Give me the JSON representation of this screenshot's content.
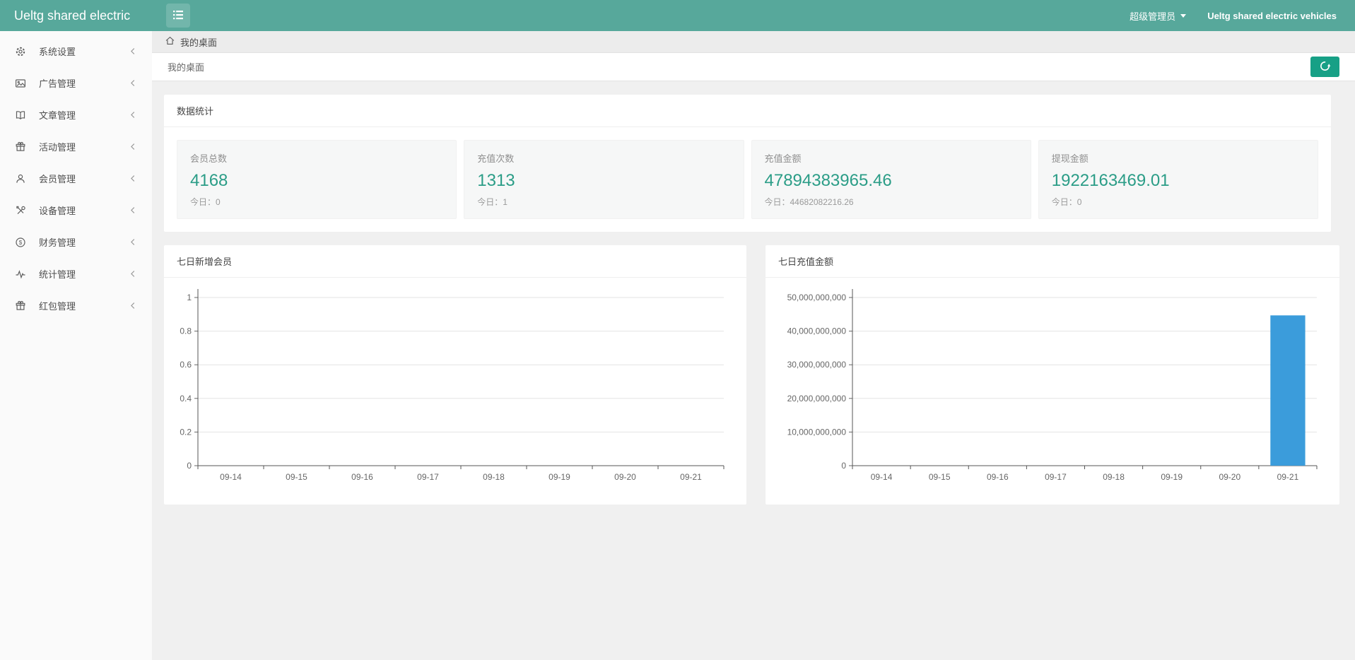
{
  "header": {
    "title": "Ueltg shared electric",
    "menu_icon": "hamburger-icon",
    "admin_role": "超级管理员",
    "site_name": "Ueltg shared electric vehicles"
  },
  "sidebar": {
    "items": [
      {
        "key": "settings",
        "icon": "gear",
        "label": "系统设置"
      },
      {
        "key": "ads",
        "icon": "image",
        "label": "广告管理"
      },
      {
        "key": "articles",
        "icon": "book",
        "label": "文章管理"
      },
      {
        "key": "activities",
        "icon": "gift",
        "label": "活动管理"
      },
      {
        "key": "members",
        "icon": "user",
        "label": "会员管理"
      },
      {
        "key": "devices",
        "icon": "wrench",
        "label": "设备管理"
      },
      {
        "key": "finance",
        "icon": "dollar",
        "label": "财务管理"
      },
      {
        "key": "statistics",
        "icon": "pulse",
        "label": "统计管理"
      },
      {
        "key": "redpacket",
        "icon": "gift",
        "label": "红包管理"
      }
    ]
  },
  "breadcrumb": {
    "icon": "home-icon",
    "label": "我的桌面"
  },
  "tab": {
    "label": "我的桌面",
    "refresh_icon": "refresh-icon"
  },
  "stats": {
    "section_title": "数据统计",
    "today_prefix": "今日：",
    "cards": [
      {
        "label": "会员总数",
        "value": "4168",
        "today": "0"
      },
      {
        "label": "充值次数",
        "value": "1313",
        "today": "1"
      },
      {
        "label": "充值金额",
        "value": "47894383965.46",
        "today": "44682082216.26"
      },
      {
        "label": "提现金额",
        "value": "1922163469.01",
        "today": "0"
      }
    ]
  },
  "chart_data": [
    {
      "type": "line",
      "title": "七日新增会员",
      "categories": [
        "09-14",
        "09-15",
        "09-16",
        "09-17",
        "09-18",
        "09-19",
        "09-20",
        "09-21"
      ],
      "values": [],
      "ylim": [
        0,
        1
      ],
      "yticks": [
        "1",
        "0.8",
        "0.6",
        "0.4",
        "0.2",
        "0"
      ],
      "grid": true,
      "legend": false
    },
    {
      "type": "bar",
      "title": "七日充值金额",
      "categories": [
        "09-14",
        "09-15",
        "09-16",
        "09-17",
        "09-18",
        "09-19",
        "09-20",
        "09-21"
      ],
      "values": [
        0,
        0,
        0,
        0,
        0,
        0,
        0,
        44682082216.26
      ],
      "ylim": [
        0,
        50000000000
      ],
      "yticks": [
        "50,000,000,000",
        "40,000,000,000",
        "30,000,000,000",
        "20,000,000,000",
        "10,000,000,000",
        "0"
      ],
      "grid": true,
      "legend": false,
      "bar_color": "#3B9CDB"
    }
  ],
  "colors": {
    "header_bg": "#57A89B",
    "accent_green": "#17A086",
    "stat_value": "#2B9D87",
    "bar_blue": "#3B9CDB",
    "page_bg": "#F0F0F0"
  }
}
